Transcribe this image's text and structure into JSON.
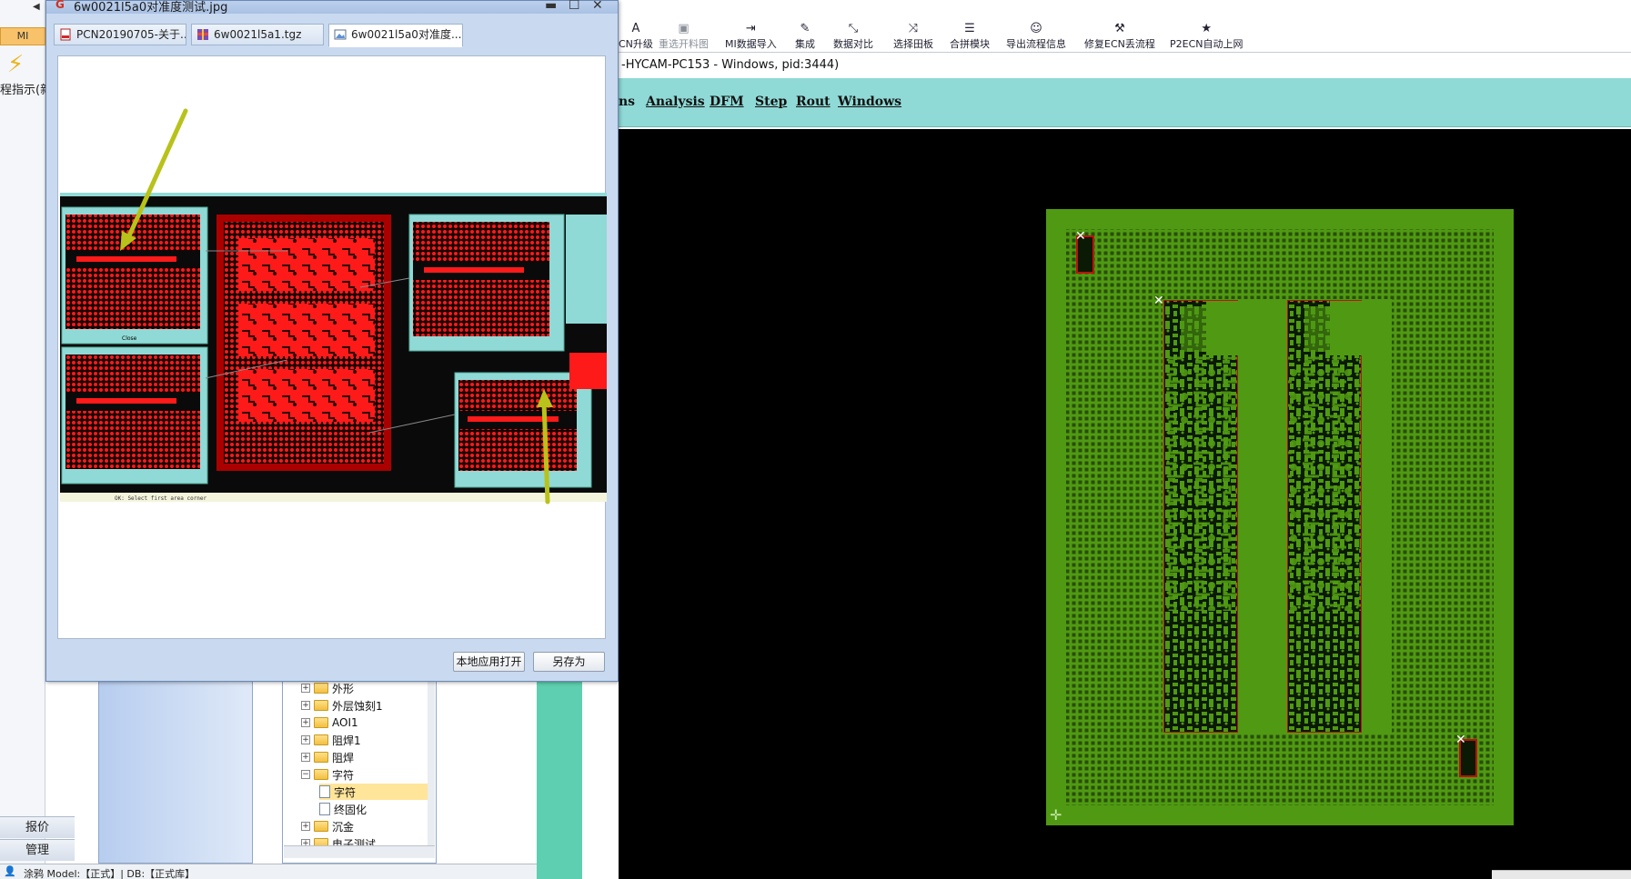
{
  "background_app": {
    "left_tab_label": "MI",
    "left_menu_text": "程指示(新",
    "bottom_items": [
      "报价",
      "管理"
    ],
    "tree_items": [
      {
        "label": "外形",
        "type": "folder"
      },
      {
        "label": "外层蚀刻1",
        "type": "folder"
      },
      {
        "label": "AOI1",
        "type": "folder"
      },
      {
        "label": "阻焊1",
        "type": "folder"
      },
      {
        "label": "阻焊",
        "type": "folder"
      },
      {
        "label": "字符",
        "type": "folder"
      },
      {
        "label": "字符",
        "type": "file",
        "selected": true
      },
      {
        "label": "终固化",
        "type": "file"
      },
      {
        "label": "沉金",
        "type": "folder"
      },
      {
        "label": "电子测试",
        "type": "folder"
      }
    ],
    "status_text": "涂鸦      Model:【正式】| DB:【正式库】"
  },
  "cam": {
    "toolbar": [
      {
        "label": "CN升级",
        "icon": "font-a-icon",
        "dim": false
      },
      {
        "label": "重选开料图",
        "icon": "image-icon",
        "dim": true
      },
      {
        "label": "MI数据导入",
        "icon": "import-icon",
        "dim": false
      },
      {
        "label": "集成",
        "icon": "pin-icon",
        "dim": false
      },
      {
        "label": "数据对比",
        "icon": "compare-icon",
        "dim": false
      },
      {
        "label": "选择田板",
        "icon": "shuffle-icon",
        "dim": false
      },
      {
        "label": "合拼模块",
        "icon": "list-icon",
        "dim": false
      },
      {
        "label": "导出流程信息",
        "icon": "smiley-icon",
        "dim": false
      },
      {
        "label": "修复ECN丢流程",
        "icon": "wrench-icon",
        "dim": false
      },
      {
        "label": "P2ECN自动上网",
        "icon": "star-icon",
        "dim": false
      }
    ],
    "title": "-HYCAM-PC153 - Windows, pid:3444)",
    "menu": [
      "ns",
      "Analysis",
      "DFM",
      "Step",
      "Rout",
      "Windows"
    ]
  },
  "viewer": {
    "title": "6w0021l5a0对准度测试.jpg",
    "tabs": [
      {
        "label": "PCN20190705-关于...",
        "icon": "pdf-icon",
        "active": false
      },
      {
        "label": "6w0021l5a1.tgz",
        "icon": "archive-icon",
        "active": false
      },
      {
        "label": "6w0021l5a0对准度...",
        "icon": "image-file-icon",
        "active": true
      }
    ],
    "open_local_label": "本地应用打开",
    "save_as_label": "另存为",
    "screenshot_popup_label": "Close",
    "screenshot_status": "OK: Select first area corner"
  },
  "colors": {
    "board_green": "#4f9a12",
    "grid_dark": "#2a4d0a",
    "copper_red": "#ff1a1a",
    "menu_teal": "#8fdad6",
    "arrow_yellow": "#b8c21a"
  }
}
